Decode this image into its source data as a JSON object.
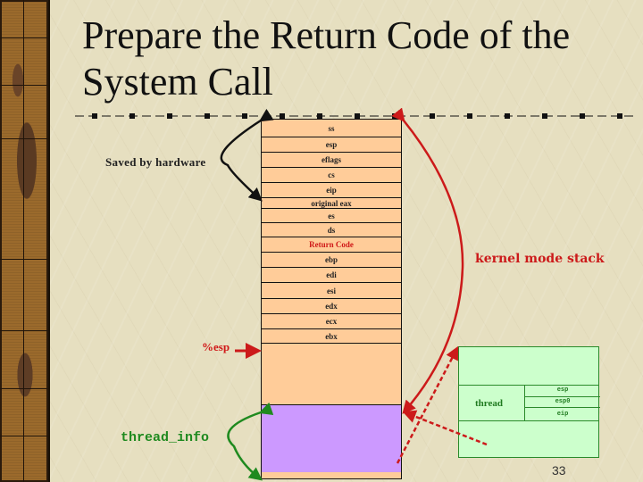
{
  "slide": {
    "title_line1": "Prepare the Return Code of the",
    "title_line2": "System Call",
    "page_number": "33"
  },
  "stack": {
    "cells": [
      {
        "label": "ss",
        "style": "normal"
      },
      {
        "label": "esp",
        "style": "normal"
      },
      {
        "label": "eflags",
        "style": "normal"
      },
      {
        "label": "cs",
        "style": "normal"
      },
      {
        "label": "eip",
        "style": "normal"
      },
      {
        "label": "original eax",
        "style": "normal"
      },
      {
        "label": "es",
        "style": "normal"
      },
      {
        "label": "ds",
        "style": "normal"
      },
      {
        "label": "Return Code",
        "style": "red"
      },
      {
        "label": "ebp",
        "style": "normal"
      },
      {
        "label": "edi",
        "style": "normal"
      },
      {
        "label": "esi",
        "style": "normal"
      },
      {
        "label": "edx",
        "style": "normal"
      },
      {
        "label": "ecx",
        "style": "normal"
      },
      {
        "label": "ebx",
        "style": "normal"
      },
      {
        "label": "",
        "style": "normal"
      },
      {
        "label": "",
        "style": "purple"
      }
    ],
    "colors": {
      "stack_fill": "#ffcc99",
      "thread_info_fill": "#cc99ff"
    }
  },
  "labels": {
    "saved_by_hardware": "Saved by hardware",
    "kernel_mode_stack": "kernel mode stack",
    "esp_pointer": "%esp",
    "thread_info": "thread_info"
  },
  "thread_struct": {
    "label": "thread",
    "fields": [
      "esp",
      "esp0",
      "eip"
    ],
    "colors": {
      "fill": "#ccffcc",
      "border": "#2a8a2a"
    }
  },
  "colors": {
    "accent_red": "#cc1a1a",
    "accent_green": "#1f8a1f"
  }
}
